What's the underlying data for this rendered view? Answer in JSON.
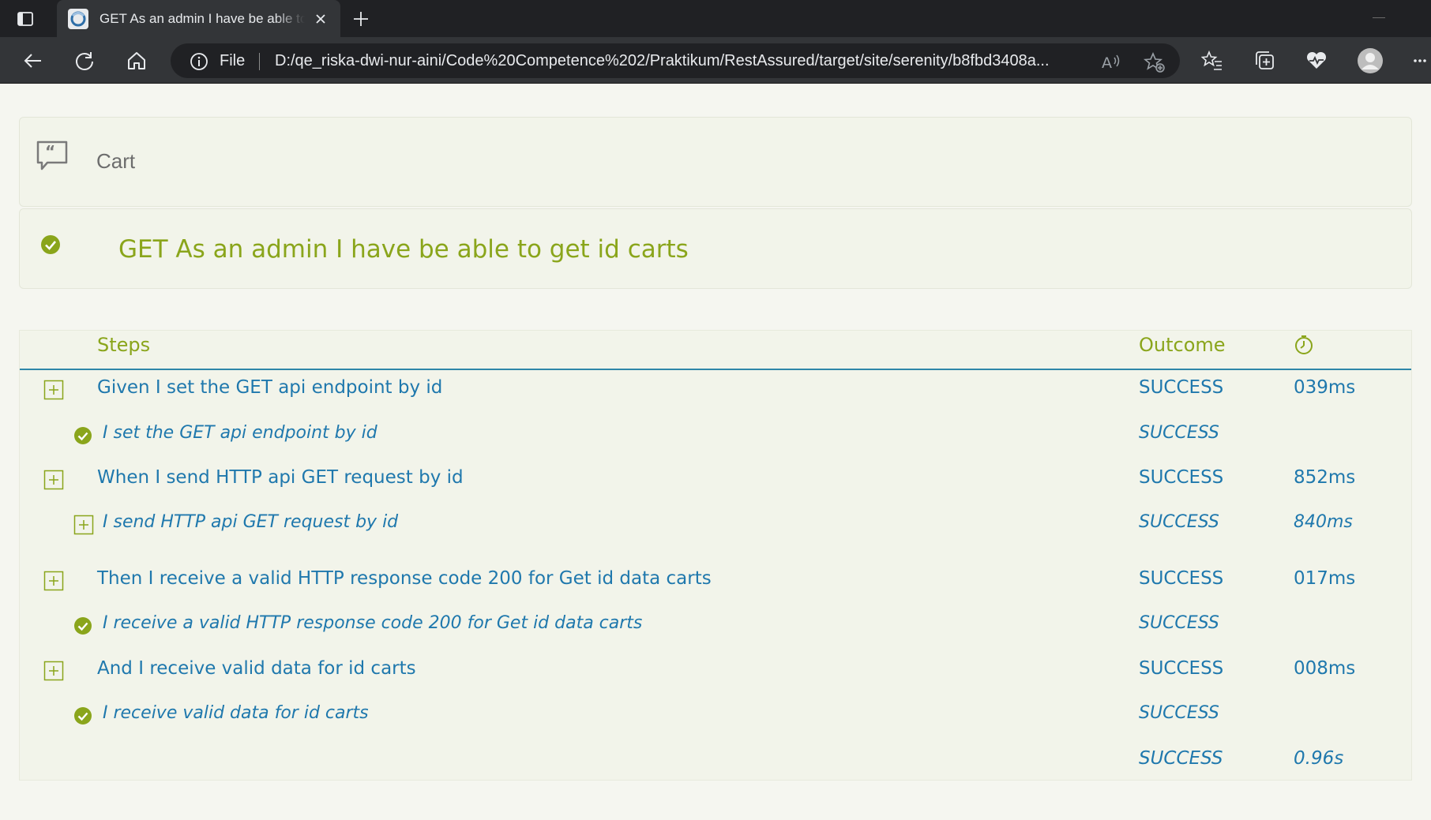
{
  "browser": {
    "tab_title": "GET As an admin I have be able to get id carts",
    "address_scheme": "File",
    "url": "D:/qe_riska-dwi-nur-aini/Code%20Competence%202/Praktikum/RestAssured/target/site/serenity/b8fbd3408a..."
  },
  "cart": {
    "label": "Cart"
  },
  "scenario": {
    "title": "GET As an admin I have be able to get id carts",
    "status_color": "#8aa51b"
  },
  "table": {
    "headers": {
      "steps": "Steps",
      "outcome": "Outcome"
    },
    "rows": [
      {
        "description": "Given I set the GET api endpoint by id",
        "outcome": "SUCCESS",
        "duration": "039ms"
      },
      {
        "description": "I set the GET api endpoint by id",
        "outcome": "SUCCESS",
        "duration": ""
      },
      {
        "description": "When I send HTTP api GET request by id",
        "outcome": "SUCCESS",
        "duration": "852ms"
      },
      {
        "description": "I send HTTP api GET request by id",
        "outcome": "SUCCESS",
        "duration": "840ms"
      },
      {
        "description": "Then I receive a valid HTTP response code 200 for Get id data carts",
        "outcome": "SUCCESS",
        "duration": "017ms"
      },
      {
        "description": "I receive a valid HTTP response code 200 for Get id data carts",
        "outcome": "SUCCESS",
        "duration": ""
      },
      {
        "description": "And I receive valid data for id carts",
        "outcome": "SUCCESS",
        "duration": "008ms"
      },
      {
        "description": "I receive valid data for id carts",
        "outcome": "SUCCESS",
        "duration": ""
      }
    ],
    "total": {
      "outcome": "SUCCESS",
      "duration": "0.96s"
    }
  },
  "colors": {
    "accent_green": "#8aa51b",
    "link_blue": "#1f78ad",
    "header_rule": "#2e86a8"
  }
}
